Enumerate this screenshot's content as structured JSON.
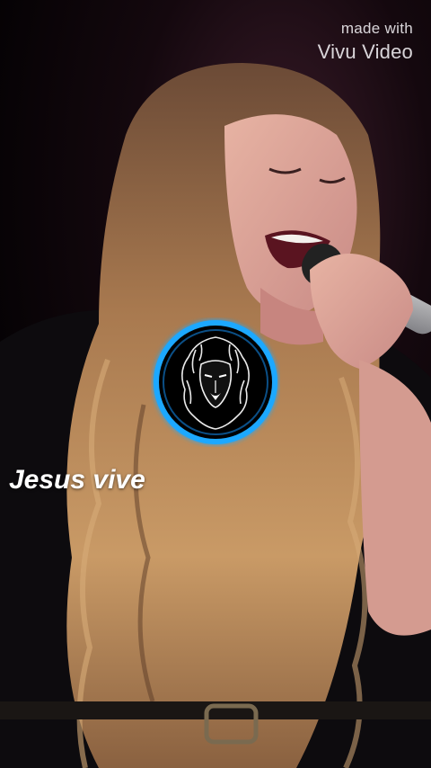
{
  "watermark": {
    "line1": "made with",
    "line2": "Vivu Video"
  },
  "caption": {
    "text": "Jesus vive"
  },
  "badge": {
    "icon": "lion-head-icon",
    "ring_color": "#1ea8ff"
  },
  "photo": {
    "icon": "singer-with-microphone"
  }
}
